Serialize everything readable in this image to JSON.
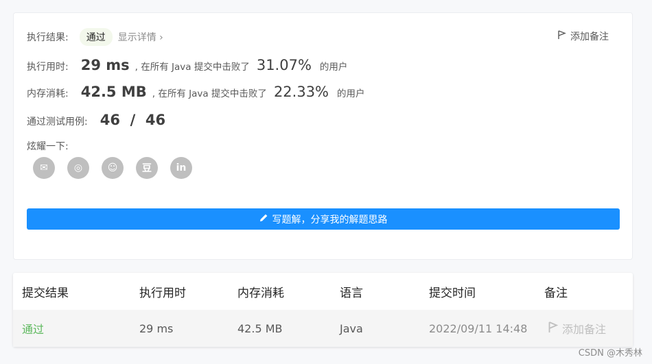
{
  "result": {
    "label": "执行结果:",
    "status": "通过",
    "details_link": "显示详情 ›",
    "add_note": "添加备注"
  },
  "runtime": {
    "label": "执行用时:",
    "value": "29 ms",
    "text": ", 在所有 Java 提交中击败了",
    "percent": "31.07%",
    "suffix": "的用户"
  },
  "memory": {
    "label": "内存消耗:",
    "value": "42.5 MB",
    "text": ", 在所有 Java 提交中击败了",
    "percent": "22.33%",
    "suffix": "的用户"
  },
  "testcases": {
    "label": "通过测试用例:",
    "value": "46  /  46"
  },
  "share": {
    "label": "炫耀一下:",
    "icons": [
      "wechat-icon",
      "weibo-icon",
      "qq-icon",
      "douban-icon",
      "linkedin-icon"
    ],
    "glyphs": [
      "✉",
      "◎",
      "☺",
      "豆",
      "in"
    ]
  },
  "write_button": "写题解，分享我的解题思路",
  "table": {
    "headers": [
      "提交结果",
      "执行用时",
      "内存消耗",
      "语言",
      "提交时间",
      "备注"
    ],
    "row": {
      "result": "通过",
      "runtime": "29 ms",
      "memory": "42.5 MB",
      "language": "Java",
      "time": "2022/09/11 14:48",
      "note": "添加备注"
    }
  },
  "watermark": "CSDN @木秀林",
  "colors": {
    "accent": "#1a90ff",
    "pass": "#5cb85c",
    "pill_bg": "#f3f8ec"
  }
}
